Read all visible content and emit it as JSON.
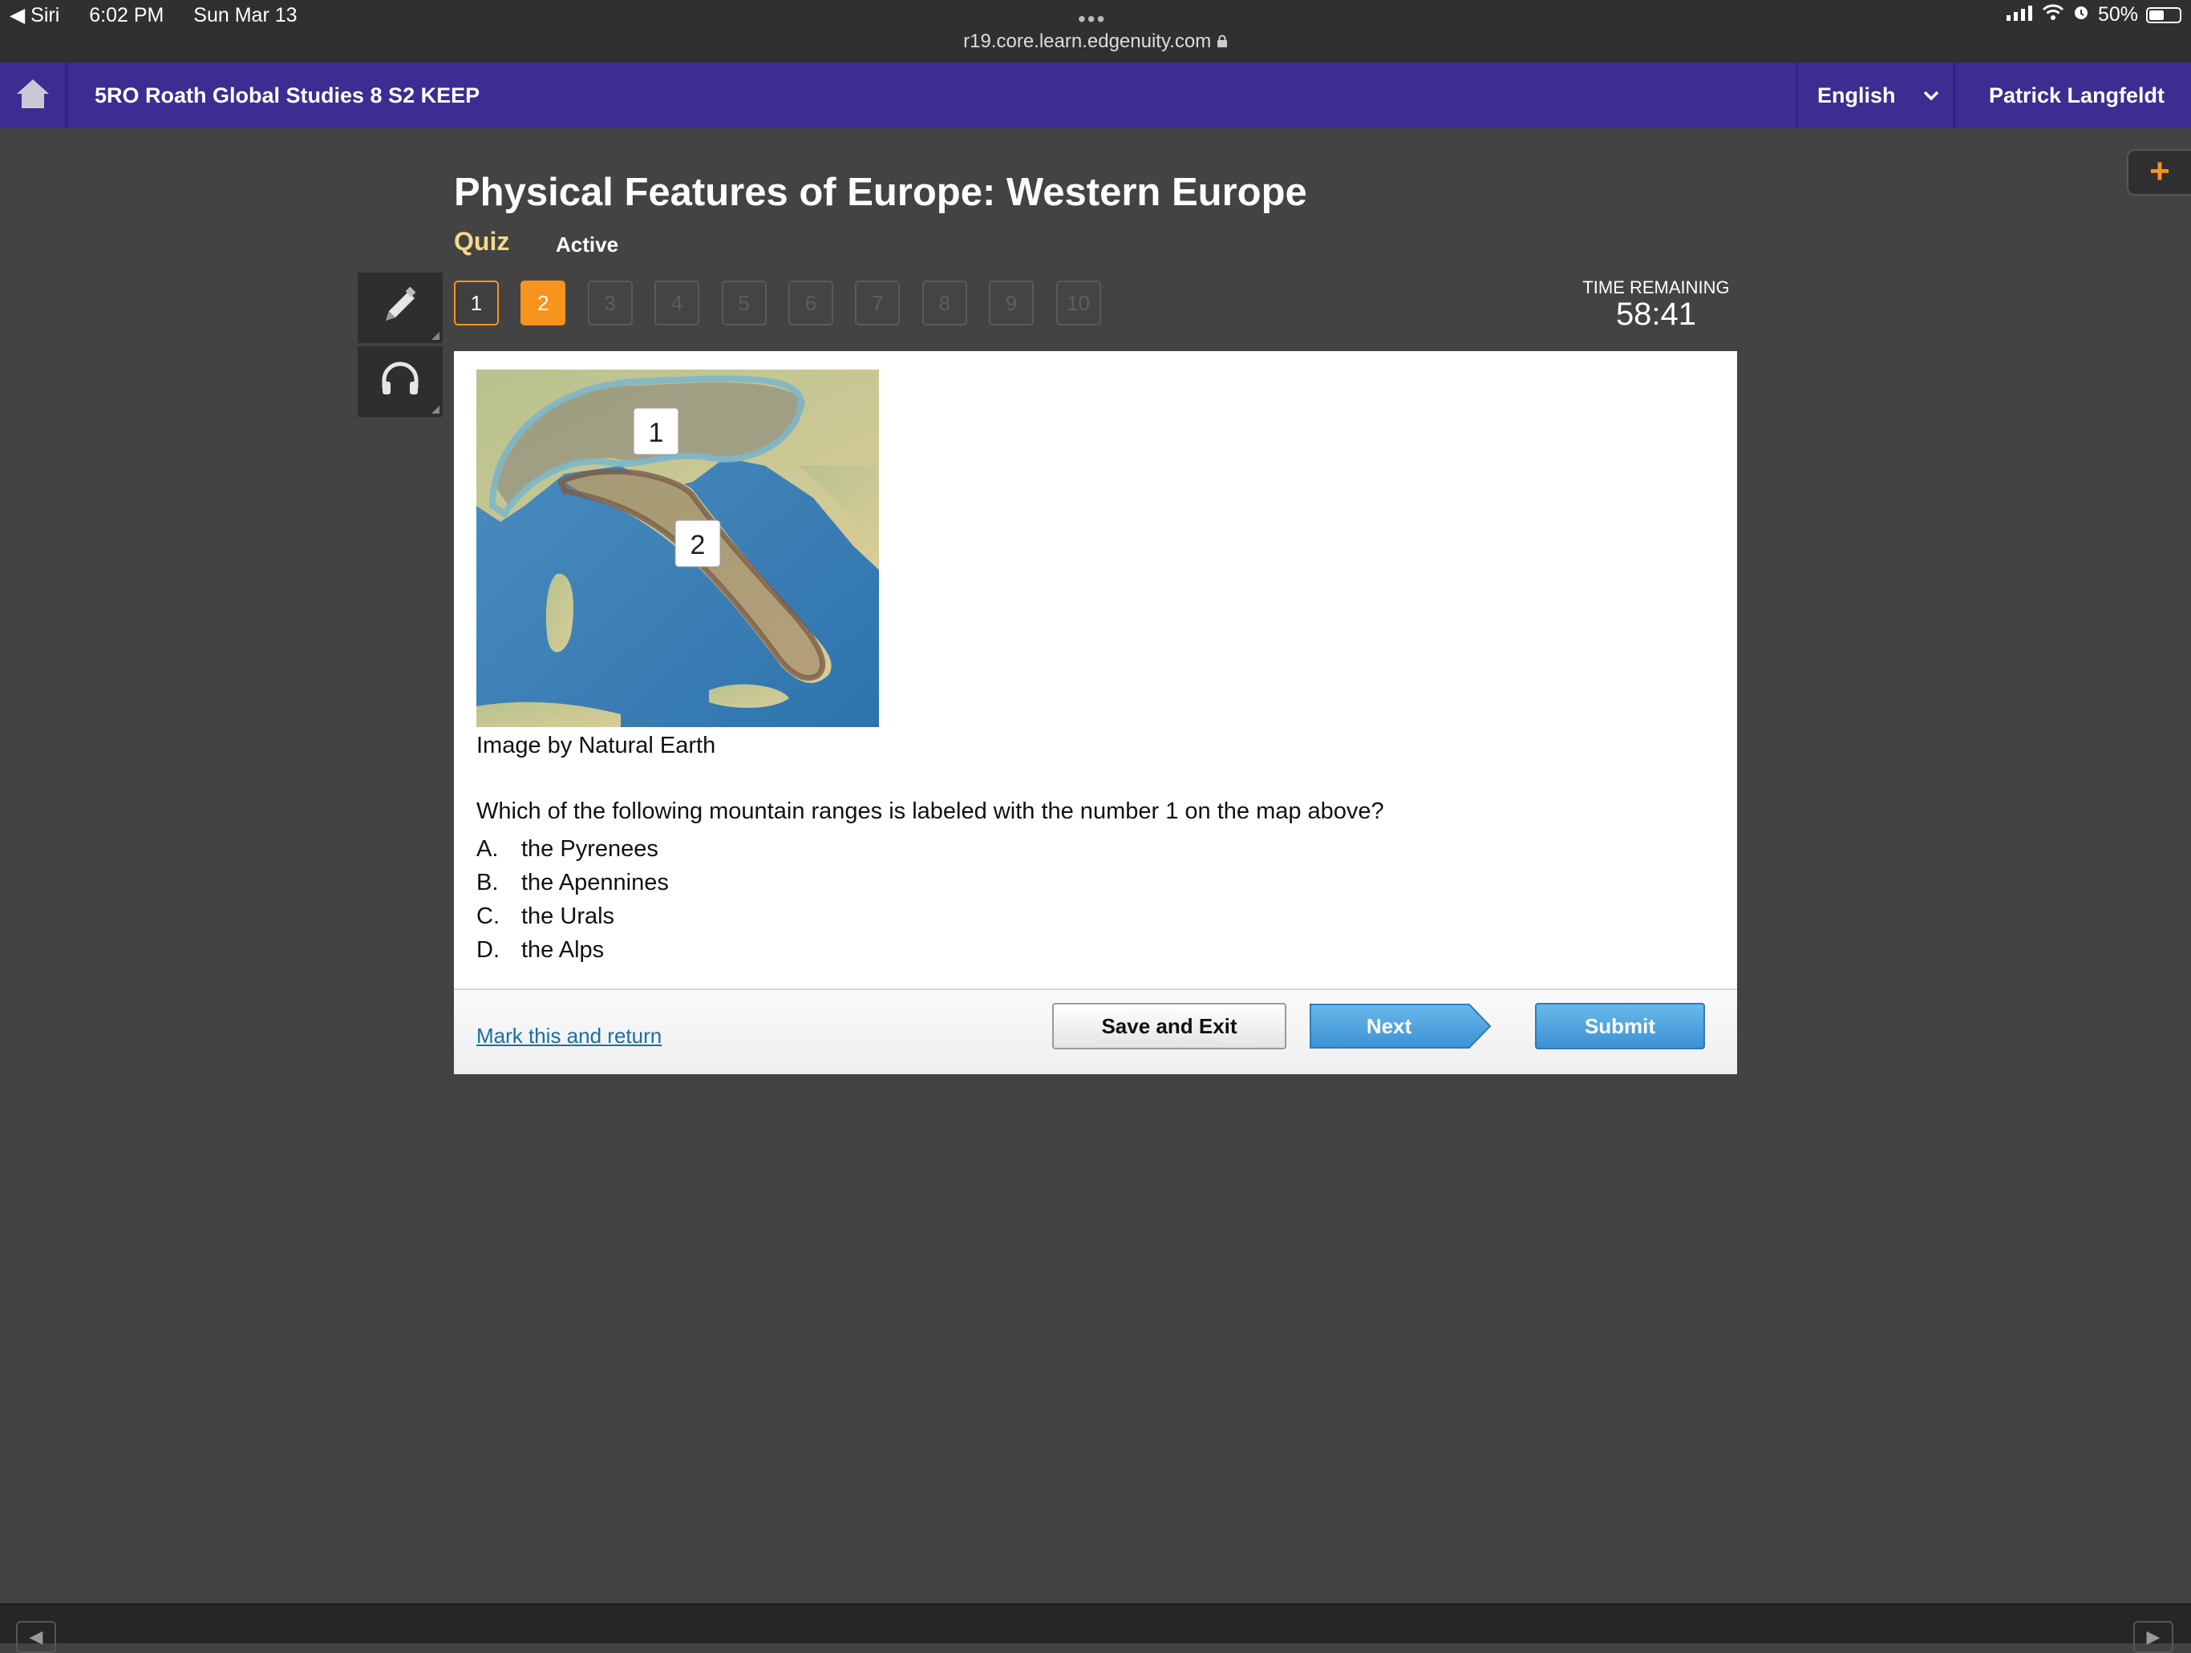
{
  "status_bar": {
    "back_app": "◀ Siri",
    "time": "6:02 PM",
    "date": "Sun Mar 13",
    "url": "r19.core.learn.edgenuity.com",
    "battery": "50%"
  },
  "header": {
    "course_title": "5RO Roath Global Studies 8 S2 KEEP",
    "language": "English",
    "user_name": "Patrick Langfeldt"
  },
  "lesson": {
    "title": "Physical Features of Europe: Western Europe",
    "type": "Quiz",
    "status": "Active"
  },
  "question_nav": {
    "items": [
      {
        "label": "1",
        "state": "answered"
      },
      {
        "label": "2",
        "state": "current"
      },
      {
        "label": "3",
        "state": "locked"
      },
      {
        "label": "4",
        "state": "locked"
      },
      {
        "label": "5",
        "state": "locked"
      },
      {
        "label": "6",
        "state": "locked"
      },
      {
        "label": "7",
        "state": "locked"
      },
      {
        "label": "8",
        "state": "locked"
      },
      {
        "label": "9",
        "state": "locked"
      },
      {
        "label": "10",
        "state": "locked"
      }
    ]
  },
  "timer": {
    "label": "TIME REMAINING",
    "value": "58:41"
  },
  "map": {
    "label_1": "1",
    "label_2": "2"
  },
  "question": {
    "image_credit": "Image by Natural Earth",
    "prompt": "Which of the following mountain ranges is labeled with the number 1 on the map above?",
    "answers": [
      {
        "letter": "A.",
        "text": "the Pyrenees"
      },
      {
        "letter": "B.",
        "text": "the Apennines"
      },
      {
        "letter": "C.",
        "text": "the Urals"
      },
      {
        "letter": "D.",
        "text": "the Alps"
      }
    ]
  },
  "footer": {
    "mark_link": "Mark this and return",
    "save_exit": "Save and Exit",
    "next": "Next",
    "submit": "Submit"
  },
  "colors": {
    "header_purple": "#3b2d92",
    "accent_orange": "#f7941d",
    "quiz_yellow": "#f5d98a",
    "button_blue": "#4ba3df",
    "background": "#434343"
  }
}
